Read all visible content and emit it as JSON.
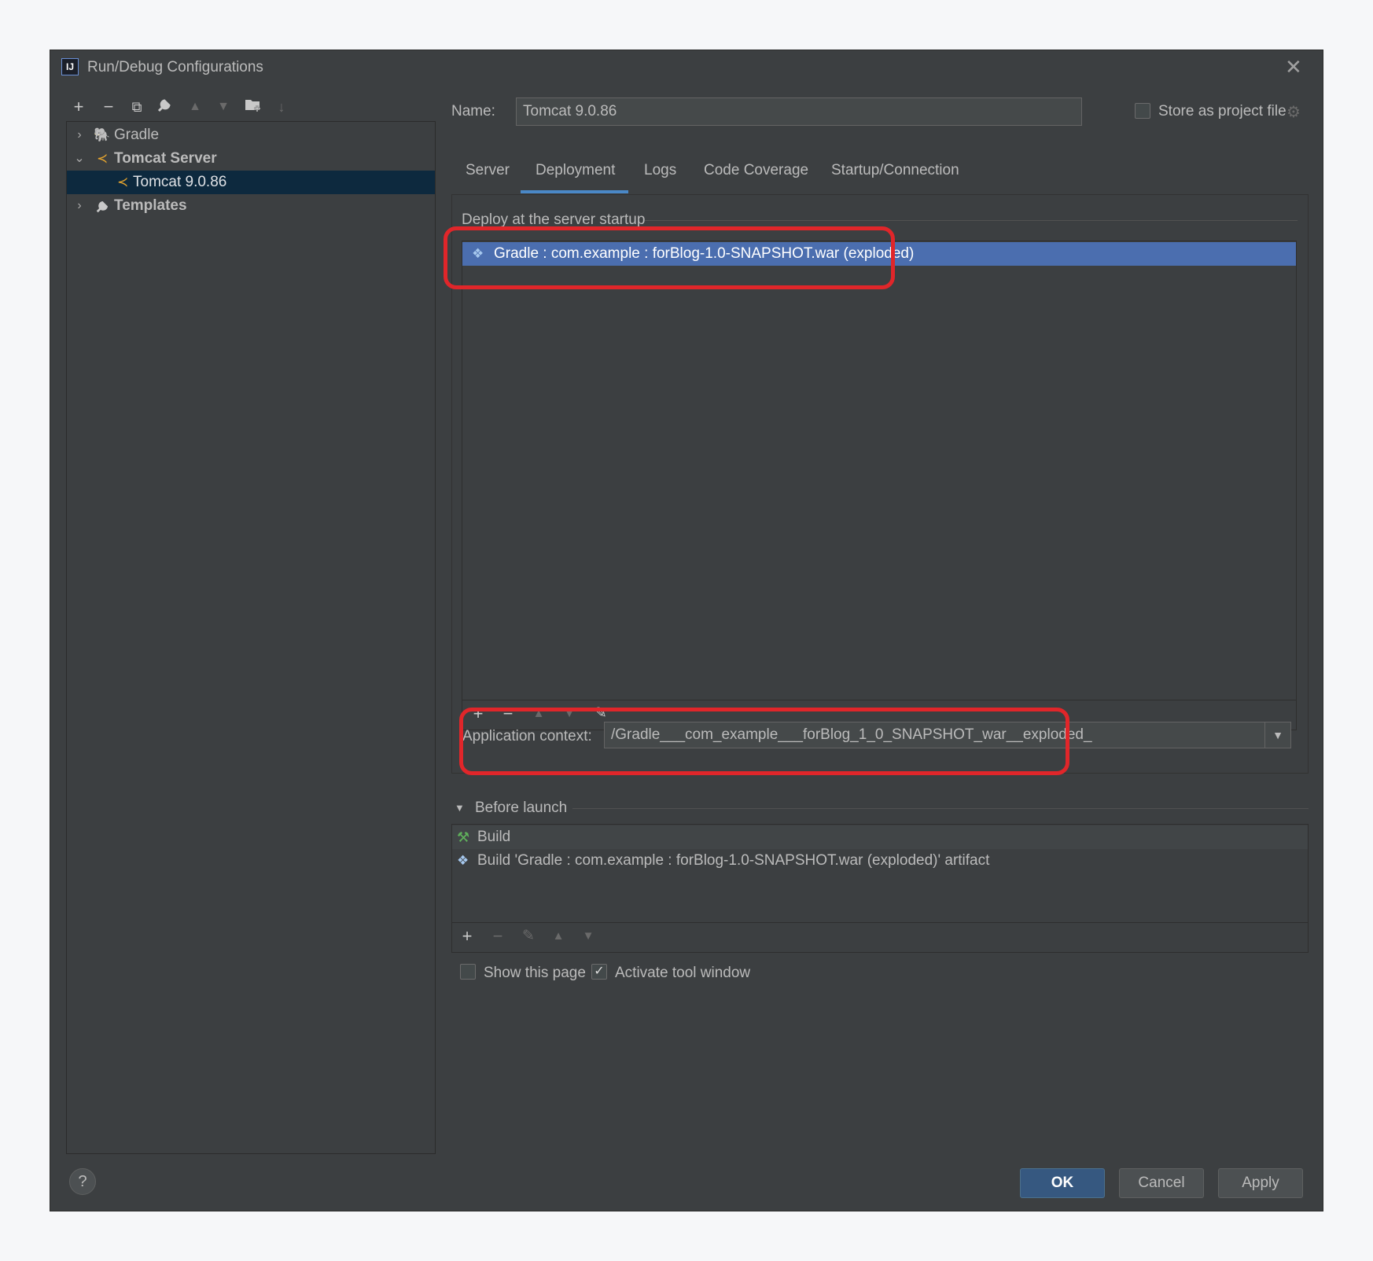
{
  "window": {
    "title": "Run/Debug Configurations",
    "close_icon": "close-icon"
  },
  "left_toolbar": {
    "icons": [
      "add-icon",
      "remove-icon",
      "copy-icon",
      "wrench-icon",
      "move-up-icon",
      "move-down-icon",
      "new-folder-icon",
      "sort-icon"
    ]
  },
  "tree": {
    "items": [
      {
        "label": "Gradle",
        "expanded": false,
        "icon": "gradle-elephant-icon"
      },
      {
        "label": "Tomcat Server",
        "expanded": true,
        "icon": "tomcat-icon"
      },
      {
        "label": "Tomcat 9.0.86",
        "selected": true,
        "icon": "tomcat-icon"
      },
      {
        "label": "Templates",
        "expanded": false,
        "icon": "wrench-icon"
      }
    ]
  },
  "name_row": {
    "label": "Name:",
    "value": "Tomcat 9.0.86",
    "store_label": "Store as project file",
    "store_checked": false
  },
  "tabs": [
    {
      "label": "Server"
    },
    {
      "label": "Deployment",
      "active": true
    },
    {
      "label": "Logs"
    },
    {
      "label": "Code Coverage"
    },
    {
      "label": "Startup/Connection"
    }
  ],
  "deployment": {
    "section_title": "Deploy at the server startup",
    "items": [
      "Gradle : com.example : forBlog-1.0-SNAPSHOT.war (exploded)"
    ],
    "toolbar": [
      "add-icon",
      "remove-icon",
      "move-up-icon",
      "move-down-icon",
      "edit-icon"
    ],
    "app_context_label": "Application context:",
    "app_context_value": "/Gradle___com_example___forBlog_1_0_SNAPSHOT_war__exploded_"
  },
  "before_launch": {
    "title": "Before launch",
    "items": [
      {
        "label": "Build",
        "icon": "hammer-icon"
      },
      {
        "label": "Build 'Gradle : com.example : forBlog-1.0-SNAPSHOT.war (exploded)' artifact",
        "icon": "artifact-icon"
      }
    ],
    "toolbar": [
      "add-icon",
      "remove-icon",
      "edit-icon",
      "move-up-icon",
      "move-down-icon"
    ],
    "show_page_label": "Show this page",
    "show_page_checked": false,
    "activate_label": "Activate tool window",
    "activate_checked": true
  },
  "buttons": {
    "ok": "OK",
    "cancel": "Cancel",
    "apply": "Apply",
    "help": "?"
  },
  "colors": {
    "accent": "#4a88c7",
    "selection": "#4b6eaf",
    "highlight": "#e0262a",
    "background": "#3c3f41"
  }
}
